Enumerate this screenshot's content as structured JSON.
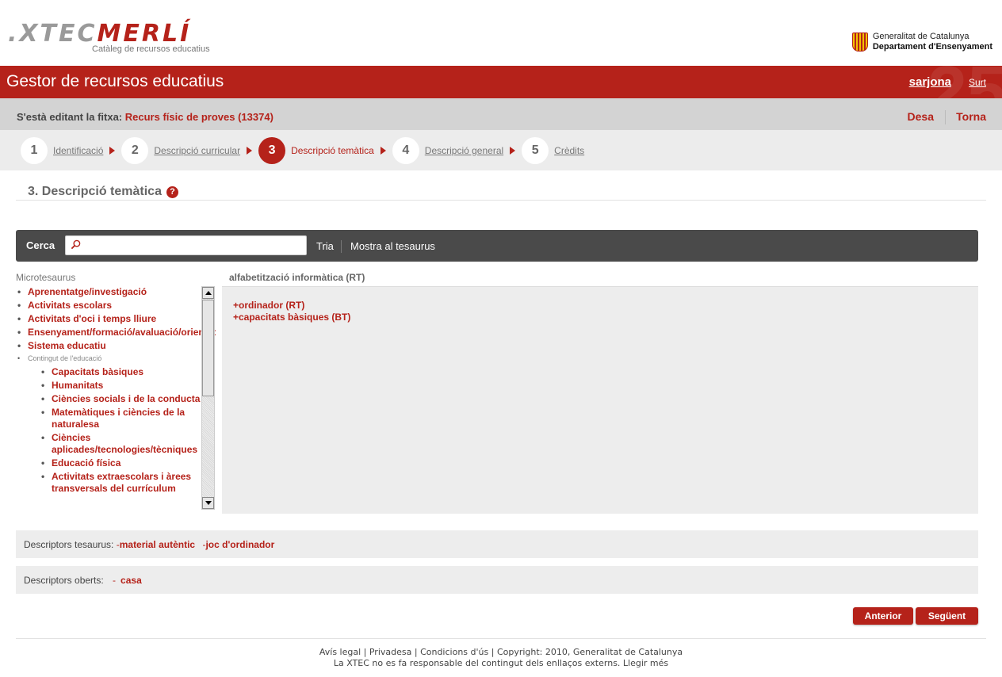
{
  "header": {
    "logo_part1": ".XTEC",
    "logo_part2": "MERLÍ",
    "logo_subtitle": "Catàleg de recursos educatius",
    "gencat_line1": "Generalitat de Catalunya",
    "gencat_line2": "Departament d'Ensenyament"
  },
  "appbar": {
    "title": "Gestor de recursos educatius",
    "user": "sarjona",
    "logout": "Surt"
  },
  "editbar": {
    "label": "S'està editant la fitxa:",
    "record": "Recurs físic de proves (13374)",
    "save": "Desa",
    "back": "Torna"
  },
  "steps": [
    {
      "num": "1",
      "label": "Identificació"
    },
    {
      "num": "2",
      "label": "Descripció curricular"
    },
    {
      "num": "3",
      "label": "Descripció temàtica"
    },
    {
      "num": "4",
      "label": "Descripció general"
    },
    {
      "num": "5",
      "label": "Crèdits"
    }
  ],
  "section": {
    "title": "3. Descripció temàtica",
    "help": "?"
  },
  "search": {
    "label": "Cerca",
    "placeholder": "",
    "choose": "Tria",
    "show_thesaurus": "Mostra al tesaurus"
  },
  "micro": {
    "title": "Microtesaurus",
    "items": [
      "Aprenentatge/investigació",
      "Activitats escolars",
      "Activitats d'oci i temps lliure",
      "Ensenyament/formació/avaluació/orientació",
      "Sistema educatiu"
    ],
    "group": "Contingut de l'educació",
    "subitems": [
      "Capacitats bàsiques",
      "Humanitats",
      "Ciències socials i de la conducta",
      "Matemàtiques i ciències de la naturalesa",
      "Ciències aplicades/tecnologies/tècniques",
      "Educació física",
      "Activitats extraescolars i àrees transversals del currículum"
    ]
  },
  "detail": {
    "title": "alfabetització informàtica (RT)",
    "relations": [
      "+ordinador (RT)",
      "+capacitats bàsiques (BT)"
    ]
  },
  "descriptors": {
    "thesaurus_label": "Descriptors tesaurus:",
    "thesaurus_tags": [
      "material autèntic",
      "joc d'ordinador"
    ],
    "open_label": "Descriptors oberts:",
    "open_tags": [
      "casa"
    ]
  },
  "buttons": {
    "prev": "Anterior",
    "next": "Següent"
  },
  "footer": {
    "legal": "Avís legal",
    "privacy": "Privadesa",
    "conditions": "Condicions d'ús",
    "copyright": "Copyright: 2010, Generalitat de Catalunya",
    "disclaimer": "La XTEC no es fa responsable del contingut dels enllaços externs.",
    "more": "Llegir més"
  },
  "colors": {
    "brand_red": "#b5221a",
    "dark_bar": "#4a4a4a",
    "panel_gray": "#ededed"
  }
}
